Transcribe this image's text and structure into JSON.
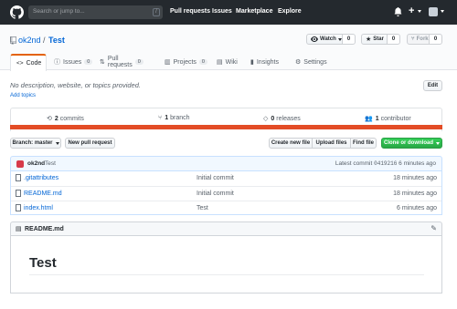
{
  "header": {
    "search_placeholder": "Search or jump to...",
    "slash_key": "/",
    "nav": [
      "Pull requests",
      "Issues",
      "Marketplace",
      "Explore"
    ],
    "plus_label": "+"
  },
  "repo": {
    "owner": "ok2nd",
    "separator": "/",
    "name": "Test",
    "watch_label": "Watch",
    "watch_count": "0",
    "star_label": "Star",
    "star_count": "0",
    "fork_label": "Fork",
    "fork_count": "0"
  },
  "tabs": [
    {
      "label": "Code"
    },
    {
      "label": "Issues",
      "count": "0"
    },
    {
      "label": "Pull requests",
      "count": "0"
    },
    {
      "label": "Projects",
      "count": "0"
    },
    {
      "label": "Wiki"
    },
    {
      "label": "Insights"
    },
    {
      "label": "Settings"
    }
  ],
  "about": {
    "description": "No description, website, or topics provided.",
    "add_topics": "Add topics",
    "edit_label": "Edit"
  },
  "summary": {
    "commits_count": "2",
    "commits_label": "commits",
    "branch_count": "1",
    "branch_label": "branch",
    "releases_count": "0",
    "releases_label": "releases",
    "contributors_count": "1",
    "contributor_label": "contributor",
    "language_color": "#e34c26"
  },
  "actions": {
    "branch_label": "Branch: master",
    "new_pr": "New pull request",
    "create_file": "Create new file",
    "upload_files": "Upload files",
    "find_file": "Find file",
    "clone": "Clone or download"
  },
  "latest_commit": {
    "author": "ok2nd",
    "message": "Test",
    "prefix": "Latest commit",
    "sha": "0419216",
    "age": "6 minutes ago"
  },
  "files": [
    {
      "name": ".gitattributes",
      "message": "Initial commit",
      "age": "18 minutes ago"
    },
    {
      "name": "README.md",
      "message": "Initial commit",
      "age": "18 minutes ago"
    },
    {
      "name": "index.html",
      "message": "Test",
      "age": "6 minutes ago"
    }
  ],
  "readme": {
    "filename": "README.md",
    "heading": "Test"
  }
}
